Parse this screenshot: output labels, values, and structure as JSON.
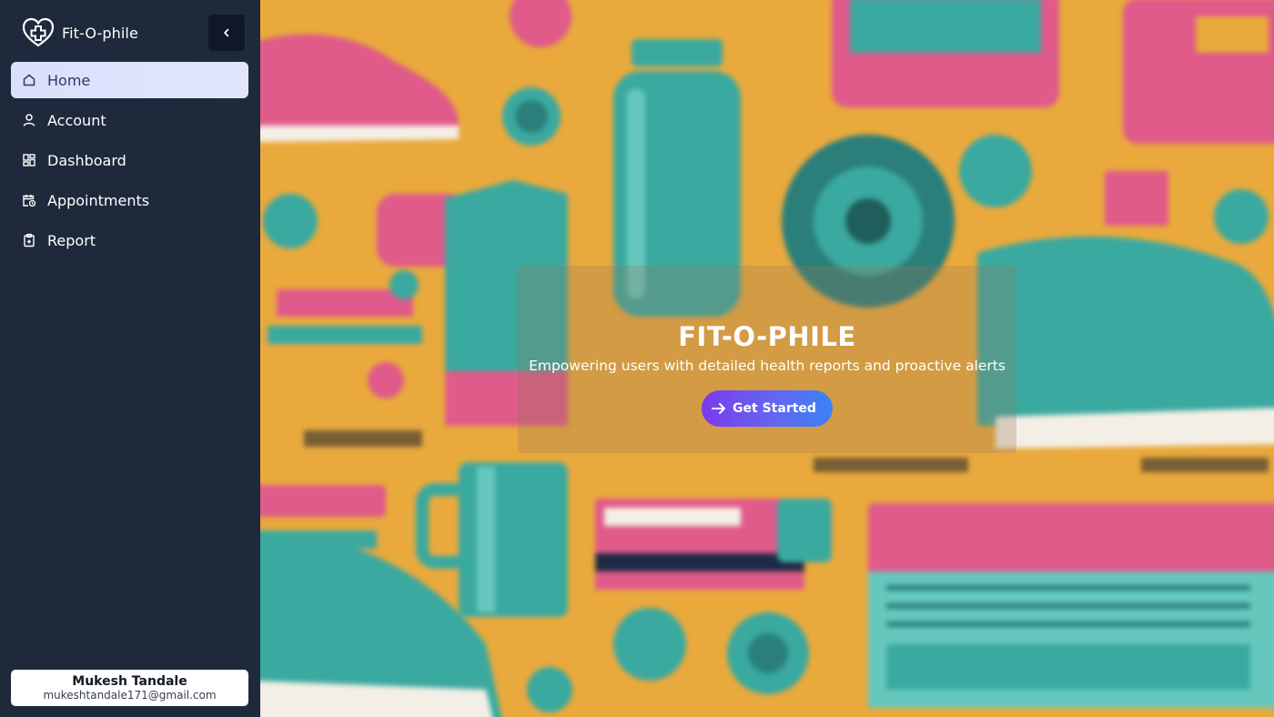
{
  "app": {
    "name": "Fit-O-phile",
    "logo_icon": "heart-plus-icon"
  },
  "sidebar": {
    "collapse_icon": "chevron-left-icon",
    "items": [
      {
        "label": "Home",
        "icon": "home-icon",
        "active": true
      },
      {
        "label": "Account",
        "icon": "user-icon",
        "active": false
      },
      {
        "label": "Dashboard",
        "icon": "dashboard-icon",
        "active": false
      },
      {
        "label": "Appointments",
        "icon": "calendar-clock-icon",
        "active": false
      },
      {
        "label": "Report",
        "icon": "clipboard-icon",
        "active": false
      }
    ]
  },
  "user": {
    "name": "Mukesh Tandale",
    "email": "mukeshtandale171@gmail.com"
  },
  "hero": {
    "title": "FIT-O-PHILE",
    "subtitle": "Empowering users with detailed health reports and proactive alerts",
    "cta_label": "Get Started",
    "cta_icon": "arrow-right-icon"
  },
  "colors": {
    "sidebar_bg": "#1e293b",
    "active_item_bg": "#dde3fb",
    "active_item_text": "#30386b",
    "hero_bg": "#e9a93c",
    "cta_gradient_start": "#7c3aed",
    "cta_gradient_end": "#3b82f6"
  }
}
